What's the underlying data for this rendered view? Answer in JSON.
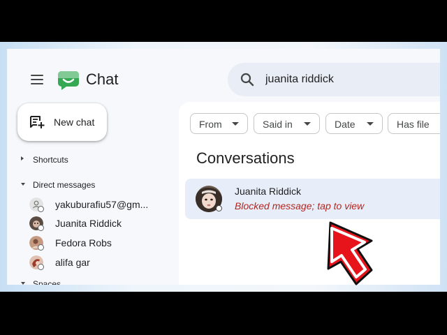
{
  "header": {
    "app_title": "Chat"
  },
  "search": {
    "query": "juanita riddick"
  },
  "sidebar": {
    "new_chat_label": "New chat",
    "shortcuts_label": "Shortcuts",
    "direct_messages_label": "Direct messages",
    "spaces_label": "Spaces",
    "dms": [
      {
        "name": "yakuburafiu57@gm..."
      },
      {
        "name": "Juanita Riddick"
      },
      {
        "name": "Fedora Robs"
      },
      {
        "name": "alifa gar"
      }
    ]
  },
  "filters": [
    "From",
    "Said in",
    "Date",
    "Has file"
  ],
  "main": {
    "heading": "Conversations",
    "results": [
      {
        "name": "Juanita Riddick",
        "preview": "Blocked message; tap to view"
      }
    ]
  },
  "colors": {
    "accent_green": "#34a853",
    "blocked_red": "#b3261e",
    "annotation_arrow": "#e8141c",
    "selected_row": "#e8eef9"
  },
  "icons": [
    "menu-icon",
    "chat-logo-icon",
    "search-icon",
    "new-chat-icon",
    "caret-down-icon",
    "caret-right-icon",
    "arrow-annotation-icon"
  ]
}
